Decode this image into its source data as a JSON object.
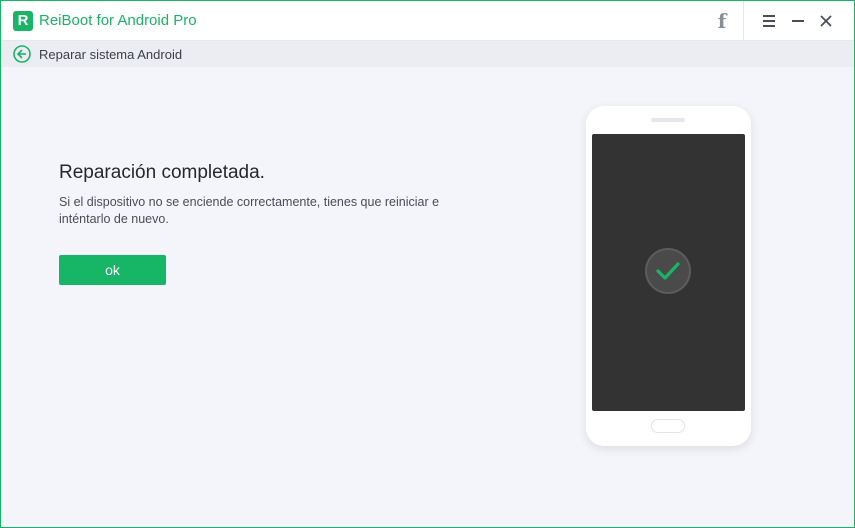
{
  "app": {
    "logo_letter": "R",
    "title": "ReiBoot for Android Pro"
  },
  "titlebar": {
    "facebook_glyph": "f",
    "icons": [
      "facebook-icon",
      "menu-icon",
      "minimize-icon",
      "close-icon"
    ]
  },
  "subbar": {
    "title": "Reparar sistema Android",
    "back_icon": "back-arrow-icon"
  },
  "main": {
    "heading": "Reparación completada.",
    "message": "Si el dispositivo no se enciende correctamente, tienes que reiniciar e inténtarlo de nuevo.",
    "ok_label": "ok"
  },
  "phone": {
    "status_icon": "checkmark-icon"
  },
  "colors": {
    "accent": "#18b566",
    "screen": "#333333",
    "background": "#f4f5fa"
  }
}
